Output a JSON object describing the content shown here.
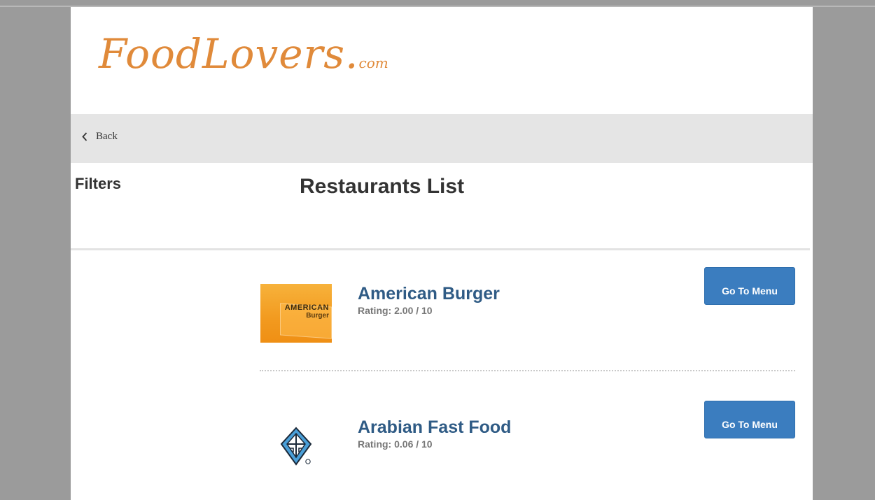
{
  "brand": {
    "name_main": "FoodLovers.",
    "name_suffix": "com"
  },
  "nav": {
    "back_label": "Back"
  },
  "sidebar": {
    "filters_title": "Filters"
  },
  "main": {
    "title": "Restaurants List",
    "restaurants": [
      {
        "name": "American Burger",
        "rating": "Rating: 2.00 / 10",
        "button_label": "Go To Menu",
        "logo_line1": "AMERICAN",
        "logo_line2": "Burger"
      },
      {
        "name": "Arabian Fast Food",
        "rating": "Rating: 0.06 / 10",
        "button_label": "Go To Menu"
      }
    ]
  },
  "colors": {
    "brand": "#e08a3a",
    "button": "#3b7dbf",
    "restaurant_name": "#2f5b85",
    "nav_background": "#e5e5e5",
    "page_background": "#ffffff",
    "outer_background": "#9b9b9b"
  }
}
